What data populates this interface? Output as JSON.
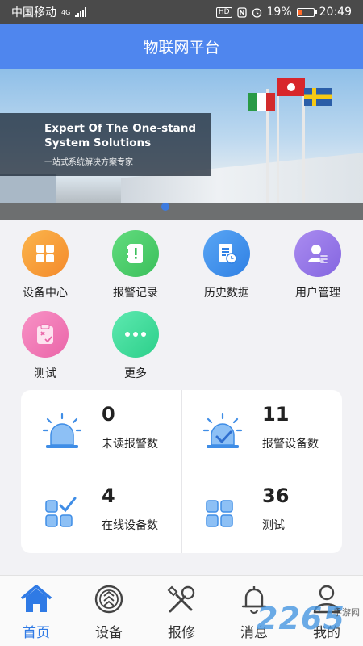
{
  "status_bar": {
    "carrier": "中国移动",
    "network": "4G",
    "battery": "19%",
    "time": "20:49"
  },
  "header": {
    "title": "物联网平台"
  },
  "banner": {
    "headline": "Expert Of The One-stand System Solutions",
    "subline": "一站式系统解决方案专家"
  },
  "menu": [
    {
      "label": "设备中心",
      "icon": "grid-icon",
      "color": "#f7a23a"
    },
    {
      "label": "报警记录",
      "icon": "alert-book-icon",
      "color": "#4cd06a"
    },
    {
      "label": "历史数据",
      "icon": "history-doc-icon",
      "color": "#3f93ec"
    },
    {
      "label": "用户管理",
      "icon": "user-manage-icon",
      "color": "#9a78e8"
    },
    {
      "label": "测试",
      "icon": "clipboard-check-icon",
      "color": "#f07bb7"
    },
    {
      "label": "更多",
      "icon": "more-dots-icon",
      "color": "#3ed99d"
    }
  ],
  "stats": [
    {
      "value": "0",
      "label": "未读报警数",
      "icon": "alarm-light-icon"
    },
    {
      "value": "11",
      "label": "报警设备数",
      "icon": "alarm-check-icon"
    },
    {
      "value": "4",
      "label": "在线设备数",
      "icon": "online-devices-icon"
    },
    {
      "value": "36",
      "label": "测试",
      "icon": "grid-blocks-icon"
    }
  ],
  "tabs": [
    {
      "label": "首页",
      "icon": "home-icon",
      "active": true
    },
    {
      "label": "设备",
      "icon": "device-icon",
      "active": false
    },
    {
      "label": "报修",
      "icon": "repair-icon",
      "active": false
    },
    {
      "label": "消息",
      "icon": "bell-icon",
      "active": false
    },
    {
      "label": "我的",
      "icon": "profile-icon",
      "active": false
    }
  ],
  "watermark": {
    "number": "2265",
    "text": "手游网"
  },
  "colors": {
    "primary": "#4f86ee",
    "active_tab": "#2f7ae5"
  }
}
